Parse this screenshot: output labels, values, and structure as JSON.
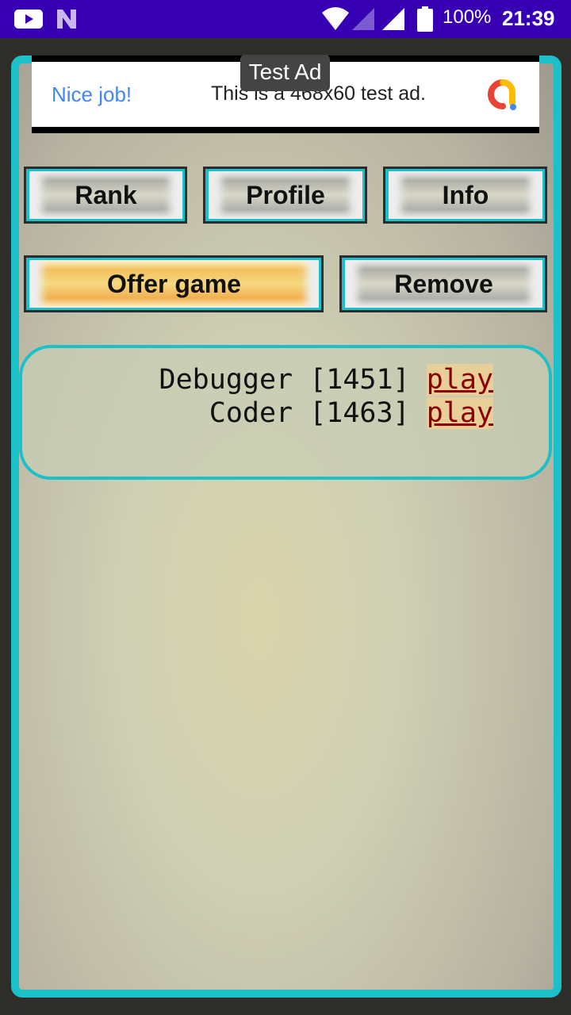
{
  "status_bar": {
    "battery": "100%",
    "time": "21:39",
    "icons": [
      "youtube-icon",
      "n-icon",
      "wifi-icon",
      "signal-icon",
      "signal-icon",
      "battery-icon"
    ]
  },
  "ad": {
    "badge": "Test Ad",
    "headline": "Nice job!",
    "message": "This is a 468x60 test ad.",
    "logo": "admob-logo"
  },
  "buttons": {
    "rank": "Rank",
    "profile": "Profile",
    "info": "Info",
    "offer_game": "Offer game",
    "remove": "Remove"
  },
  "players": [
    {
      "name": "Debugger",
      "rating": "[1451]",
      "action": "play"
    },
    {
      "name": "Coder",
      "rating": "[1463]",
      "action": "play"
    }
  ],
  "colors": {
    "status_bar": "#3700b3",
    "frame": "#1cc0c8",
    "link": "#8b0000"
  }
}
